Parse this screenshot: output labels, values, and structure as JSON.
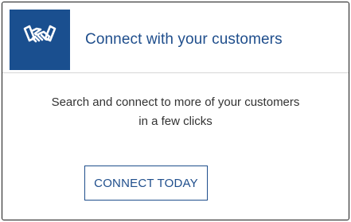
{
  "card": {
    "icon": "handshake-icon",
    "title": "Connect with your customers",
    "description_line1": "Search and connect to more of your customers",
    "description_line2": "in a few clicks",
    "button_label": "CONNECT TODAY"
  },
  "colors": {
    "accent": "#1f4e8c",
    "icon_tile": "#1a4f8f",
    "body_text": "#333333",
    "border": "#1a1a1a"
  }
}
